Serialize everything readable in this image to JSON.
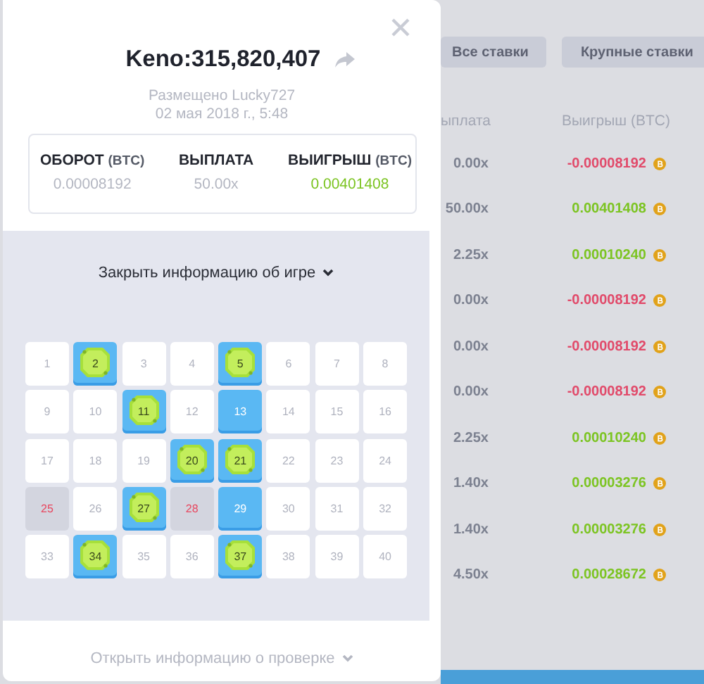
{
  "background": {
    "filters": [
      {
        "label": "Все ставки",
        "selected": false
      },
      {
        "label": "Крупные ставки",
        "selected": false
      }
    ],
    "columns": [
      "ыплата",
      "Выигрыш (BTC)"
    ],
    "rows": [
      {
        "payout": "0.00x",
        "profit": "-0.00008192",
        "color": "#e14a6a"
      },
      {
        "payout": "50.00x",
        "profit": "0.00401408",
        "color": "#7cc422"
      },
      {
        "payout": "2.25x",
        "profit": "0.00010240",
        "color": "#7cc422"
      },
      {
        "payout": "0.00x",
        "profit": "-0.00008192",
        "color": "#e14a6a"
      },
      {
        "payout": "0.00x",
        "profit": "-0.00008192",
        "color": "#e14a6a"
      },
      {
        "payout": "0.00x",
        "profit": "-0.00008192",
        "color": "#e14a6a"
      },
      {
        "payout": "2.25x",
        "profit": "0.00010240",
        "color": "#7cc422"
      },
      {
        "payout": "1.40x",
        "profit": "0.00003276",
        "color": "#7cc422"
      },
      {
        "payout": "1.40x",
        "profit": "0.00003276",
        "color": "#7cc422"
      },
      {
        "payout": "4.50x",
        "profit": "0.00028672",
        "color": "#7cc422"
      }
    ]
  },
  "modal": {
    "title": "Keno:315,820,407",
    "placed_by": "Размещено Lucky727",
    "date": "02 мая 2018 г., 5:48",
    "stats": [
      {
        "label": "ОБОРОТ",
        "unit": "(BTC)",
        "value": "0.00008192",
        "color": "#b4b7c2"
      },
      {
        "label": "ВЫПЛАТА",
        "value": "50.00x",
        "color": "#b4b7c2"
      },
      {
        "label": "ВЫИГРЫШ",
        "unit": "(BTC)",
        "value": "0.00401408",
        "color": "#7cc422"
      }
    ],
    "toggle_game_info": "Закрыть информацию об игре",
    "board": [
      {
        "number": "1",
        "picked": false,
        "drawn": false
      },
      {
        "number": "2",
        "picked": true,
        "drawn": true
      },
      {
        "number": "3",
        "picked": false,
        "drawn": false
      },
      {
        "number": "4",
        "picked": false,
        "drawn": false
      },
      {
        "number": "5",
        "picked": true,
        "drawn": true
      },
      {
        "number": "6",
        "picked": false,
        "drawn": false
      },
      {
        "number": "7",
        "picked": false,
        "drawn": false
      },
      {
        "number": "8",
        "picked": false,
        "drawn": false
      },
      {
        "number": "9",
        "picked": false,
        "drawn": false
      },
      {
        "number": "10",
        "picked": false,
        "drawn": false
      },
      {
        "number": "11",
        "picked": true,
        "drawn": true
      },
      {
        "number": "12",
        "picked": false,
        "drawn": false
      },
      {
        "number": "13",
        "picked": true,
        "drawn": false
      },
      {
        "number": "14",
        "picked": false,
        "drawn": false
      },
      {
        "number": "15",
        "picked": false,
        "drawn": false
      },
      {
        "number": "16",
        "picked": false,
        "drawn": false
      },
      {
        "number": "17",
        "picked": false,
        "drawn": false
      },
      {
        "number": "18",
        "picked": false,
        "drawn": false
      },
      {
        "number": "19",
        "picked": false,
        "drawn": false
      },
      {
        "number": "20",
        "picked": true,
        "drawn": true
      },
      {
        "number": "21",
        "picked": true,
        "drawn": true
      },
      {
        "number": "22",
        "picked": false,
        "drawn": false
      },
      {
        "number": "23",
        "picked": false,
        "drawn": false
      },
      {
        "number": "24",
        "picked": false,
        "drawn": false
      },
      {
        "number": "25",
        "picked": false,
        "drawn": true
      },
      {
        "number": "26",
        "picked": false,
        "drawn": false
      },
      {
        "number": "27",
        "picked": true,
        "drawn": true
      },
      {
        "number": "28",
        "picked": false,
        "drawn": true
      },
      {
        "number": "29",
        "picked": true,
        "drawn": false
      },
      {
        "number": "30",
        "picked": false,
        "drawn": false
      },
      {
        "number": "31",
        "picked": false,
        "drawn": false
      },
      {
        "number": "32",
        "picked": false,
        "drawn": false
      },
      {
        "number": "33",
        "picked": false,
        "drawn": false
      },
      {
        "number": "34",
        "picked": true,
        "drawn": true
      },
      {
        "number": "35",
        "picked": false,
        "drawn": false
      },
      {
        "number": "36",
        "picked": false,
        "drawn": false
      },
      {
        "number": "37",
        "picked": true,
        "drawn": true
      },
      {
        "number": "38",
        "picked": false,
        "drawn": false
      },
      {
        "number": "39",
        "picked": false,
        "drawn": false
      },
      {
        "number": "40",
        "picked": false,
        "drawn": false
      }
    ],
    "toggle_verification": "Открыть информацию о проверке"
  }
}
